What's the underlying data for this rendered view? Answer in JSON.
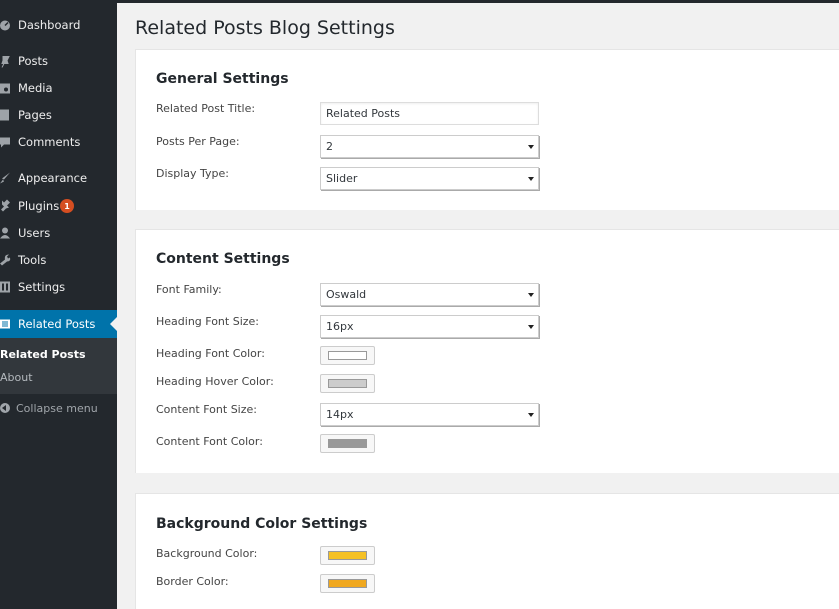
{
  "sidebar": {
    "items": [
      {
        "label": "Dashboard",
        "icon": "dashboard-icon"
      },
      {
        "label": "Posts",
        "icon": "pin-icon"
      },
      {
        "label": "Media",
        "icon": "media-icon"
      },
      {
        "label": "Pages",
        "icon": "pages-icon"
      },
      {
        "label": "Comments",
        "icon": "comment-icon"
      },
      {
        "label": "Appearance",
        "icon": "brush-icon"
      },
      {
        "label": "Plugins",
        "icon": "plug-icon",
        "badge": "1"
      },
      {
        "label": "Users",
        "icon": "users-icon"
      },
      {
        "label": "Tools",
        "icon": "wrench-icon"
      },
      {
        "label": "Settings",
        "icon": "settings-icon"
      },
      {
        "label": "Related Posts",
        "icon": "list-icon"
      }
    ],
    "submenu": [
      {
        "label": "Related Posts"
      },
      {
        "label": "About"
      }
    ],
    "collapse_label": "Collapse menu"
  },
  "page_title": "Related Posts Blog Settings",
  "general": {
    "heading": "General Settings",
    "title_label": "Related Post Title:",
    "title_value": "Related Posts",
    "per_page_label": "Posts Per Page:",
    "per_page_value": "2",
    "display_label": "Display Type:",
    "display_value": "Slider"
  },
  "content": {
    "heading": "Content Settings",
    "font_family_label": "Font Family:",
    "font_family_value": "Oswald",
    "heading_size_label": "Heading Font Size:",
    "heading_size_value": "16px",
    "heading_color_label": "Heading Font Color:",
    "heading_color": "#ffffff",
    "hover_color_label": "Heading Hover Color:",
    "hover_color": "#cccccc",
    "content_size_label": "Content Font Size:",
    "content_size_value": "14px",
    "content_color_label": "Content Font Color:",
    "content_color": "#999999"
  },
  "background": {
    "heading": "Background Color Settings",
    "bg_label": "Background Color:",
    "bg_color": "#f5c125",
    "border_label": "Border Color:",
    "border_color": "#f0a81f"
  }
}
